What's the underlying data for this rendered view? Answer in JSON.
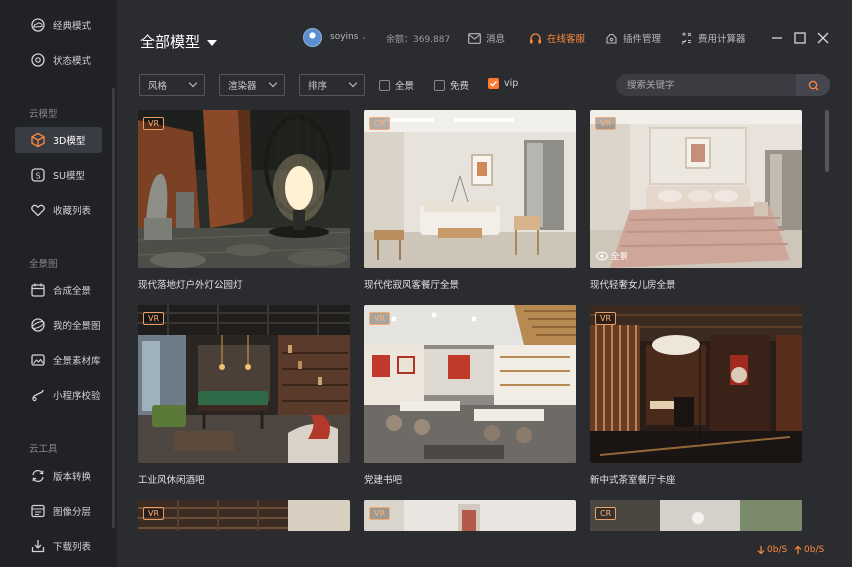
{
  "sidebar": {
    "top_items": [
      {
        "label": "经典模式",
        "icon": "cloud-icon"
      },
      {
        "label": "状态模式",
        "icon": "gear-icon"
      }
    ],
    "sections": [
      {
        "title": "云模型",
        "items": [
          {
            "label": "3D模型",
            "icon": "cube-icon",
            "active": true
          },
          {
            "label": "SU模型",
            "icon": "su-icon"
          },
          {
            "label": "收藏列表",
            "icon": "heart-icon"
          }
        ]
      },
      {
        "title": "全景图",
        "items": [
          {
            "label": "合成全景",
            "icon": "calendar-icon"
          },
          {
            "label": "我的全景图",
            "icon": "globe-icon"
          },
          {
            "label": "全景素材库",
            "icon": "image-icon"
          },
          {
            "label": "小程序校验",
            "icon": "miniapp-icon"
          }
        ]
      },
      {
        "title": "云工具",
        "items": [
          {
            "label": "版本转换",
            "icon": "convert-icon"
          },
          {
            "label": "图像分层",
            "icon": "layers-icon"
          },
          {
            "label": "下载列表",
            "icon": "download-icon"
          }
        ]
      }
    ]
  },
  "header": {
    "title": "全部模型",
    "username": "soyins",
    "balance": "余额：369.887",
    "links": [
      {
        "label": "消息",
        "icon": "mail-icon"
      },
      {
        "label": "在线客服",
        "icon": "headset-icon",
        "highlight": true
      },
      {
        "label": "插件管理",
        "icon": "plugin-icon"
      },
      {
        "label": "费用计算器",
        "icon": "calculator-icon"
      }
    ]
  },
  "filters": {
    "dropdowns": [
      "风格",
      "渲染器",
      "排序"
    ],
    "checkboxes": [
      {
        "label": "全景",
        "checked": false
      },
      {
        "label": "免费",
        "checked": false
      },
      {
        "label": "vip",
        "checked": true
      }
    ],
    "search_placeholder": "搜索关键字"
  },
  "cards": [
    {
      "title": "现代落地灯户外灯公园灯",
      "badge": "VR"
    },
    {
      "title": "现代侘寂风客餐厅全景",
      "badge": "CR"
    },
    {
      "title": "现代轻奢女儿房全景",
      "badge": "VR",
      "pano_label": "全景"
    },
    {
      "title": "工业风休闲酒吧",
      "badge": "VR"
    },
    {
      "title": "党建书吧",
      "badge": "VR"
    },
    {
      "title": "新中式茶室餐厅卡座",
      "badge": "VR"
    },
    {
      "title": "",
      "badge": "VR"
    },
    {
      "title": "",
      "badge": "VR"
    },
    {
      "title": "",
      "badge": "CR"
    }
  ],
  "status": {
    "download_speed": "0b/S",
    "upload_speed": "0b/S"
  },
  "colors": {
    "accent": "#ff7a2f",
    "sidebar_bg": "#212226",
    "main_bg": "#2b2c30"
  }
}
